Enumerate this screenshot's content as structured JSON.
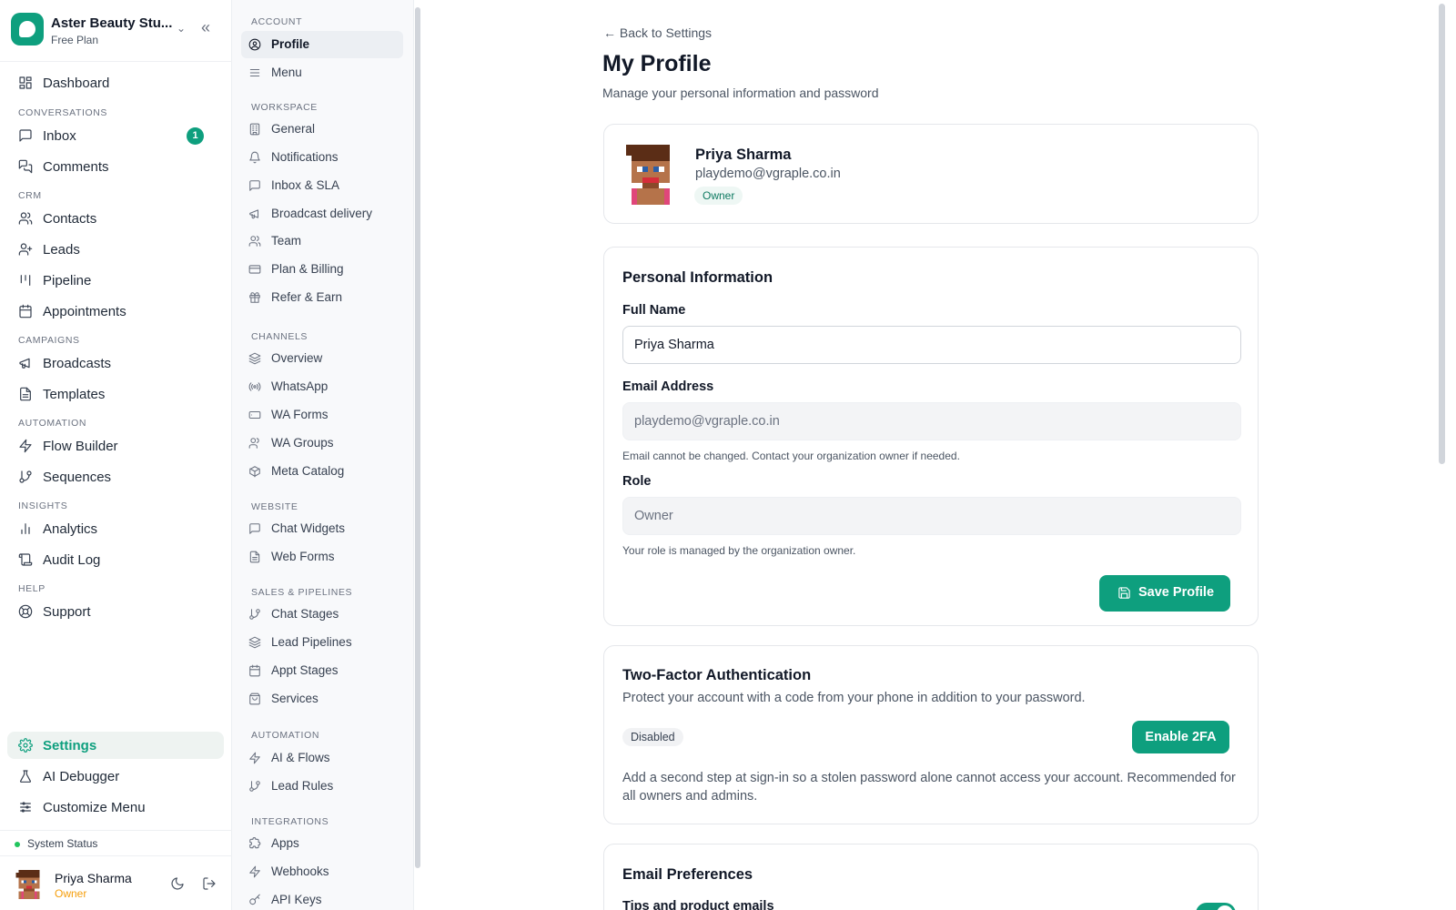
{
  "brand": {
    "name": "Aster Beauty Stu...",
    "plan": "Free Plan"
  },
  "nav": {
    "dashboard": "Dashboard",
    "sec_conversations": "CONVERSATIONS",
    "inbox": "Inbox",
    "inbox_badge": "1",
    "comments": "Comments",
    "sec_crm": "CRM",
    "contacts": "Contacts",
    "leads": "Leads",
    "pipeline": "Pipeline",
    "appointments": "Appointments",
    "sec_campaigns": "CAMPAIGNS",
    "broadcasts": "Broadcasts",
    "templates": "Templates",
    "sec_automation": "AUTOMATION",
    "flow_builder": "Flow Builder",
    "sequences": "Sequences",
    "sec_insights": "INSIGHTS",
    "analytics": "Analytics",
    "audit_log": "Audit Log",
    "sec_help": "HELP",
    "support": "Support",
    "settings": "Settings",
    "ai_debugger": "AI Debugger",
    "customize_menu": "Customize Menu",
    "system_status": "System Status"
  },
  "user": {
    "name": "Priya Sharma",
    "role": "Owner"
  },
  "subnav": {
    "sec_account": "ACCOUNT",
    "profile": "Profile",
    "menu": "Menu",
    "sec_workspace": "WORKSPACE",
    "general": "General",
    "notifications": "Notifications",
    "inbox_sla": "Inbox & SLA",
    "broadcast_delivery": "Broadcast delivery",
    "team": "Team",
    "plan_billing": "Plan & Billing",
    "refer_earn": "Refer & Earn",
    "sec_channels": "CHANNELS",
    "overview": "Overview",
    "whatsapp": "WhatsApp",
    "wa_forms": "WA Forms",
    "wa_groups": "WA Groups",
    "meta_catalog": "Meta Catalog",
    "sec_website": "WEBSITE",
    "chat_widgets": "Chat Widgets",
    "web_forms": "Web Forms",
    "sec_sales": "SALES & PIPELINES",
    "chat_stages": "Chat Stages",
    "lead_pipelines": "Lead Pipelines",
    "appt_stages": "Appt Stages",
    "services": "Services",
    "sec_automation": "AUTOMATION",
    "ai_flows": "AI & Flows",
    "lead_rules": "Lead Rules",
    "sec_integrations": "INTEGRATIONS",
    "apps": "Apps",
    "webhooks": "Webhooks",
    "api_keys": "API Keys"
  },
  "page": {
    "back": "← Back to Settings",
    "title": "My Profile",
    "subtitle": "Manage your personal information and password"
  },
  "profile_card": {
    "name": "Priya Sharma",
    "email": "playdemo@vgraple.co.in",
    "role_badge": "Owner"
  },
  "personal": {
    "title": "Personal Information",
    "full_name_label": "Full Name",
    "full_name_value": "Priya Sharma",
    "email_label": "Email Address",
    "email_value": "playdemo@vgraple.co.in",
    "email_hint": "Email cannot be changed. Contact your organization owner if needed.",
    "role_label": "Role",
    "role_value": "Owner",
    "role_hint": "Your role is managed by the organization owner.",
    "save_label": "Save Profile"
  },
  "tfa": {
    "title": "Two-Factor Authentication",
    "desc": "Protect your account with a code from your phone in addition to your password.",
    "status": "Disabled",
    "enable_label": "Enable 2FA",
    "body": "Add a second step at sign-in so a stolen password alone cannot access your account. Recommended for all owners and admins."
  },
  "email_prefs": {
    "title": "Email Preferences",
    "tips_label": "Tips and product emails"
  },
  "colors": {
    "accent": "#0e9f7e",
    "owner_role": "#f59e0b",
    "status_ok": "#22c55e"
  }
}
